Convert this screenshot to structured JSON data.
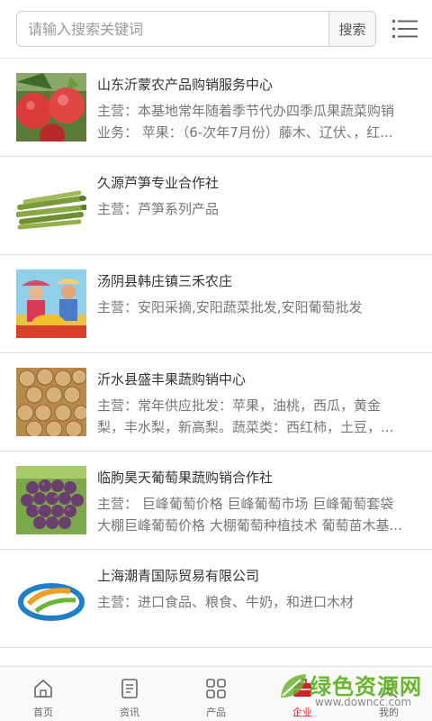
{
  "search": {
    "placeholder": "请输入搜索关键词",
    "button_label": "搜索"
  },
  "menu": {
    "icon": "list-menu-icon"
  },
  "companies": [
    {
      "name": "山东沂蒙农产品购销服务中心",
      "lines": [
        "主营：本基地常年随着季节代办四季瓜果蔬菜购销",
        "业务： 苹果：（6-次年7月份）藤木、辽伏、，红..."
      ],
      "image": "apples"
    },
    {
      "name": "久源芦笋专业合作社",
      "lines": [
        "主营：芦笋系列产品"
      ],
      "image": "asparagus"
    },
    {
      "name": "汤阴县韩庄镇三禾农庄",
      "lines": [
        "主营：安阳采摘,安阳蔬菜批发,安阳葡萄批发"
      ],
      "image": "farmers"
    },
    {
      "name": "沂水县盛丰果蔬购销中心",
      "lines": [
        "主营：常年供应批发：苹果，油桃，西瓜，黄金",
        "梨，丰水梨，新高梨。蔬菜类：西红柿，土豆，..."
      ],
      "image": "walnuts"
    },
    {
      "name": "临朐昊天葡萄果蔬购销合作社",
      "lines": [
        "主营： 巨峰葡萄价格 巨峰葡萄市场 巨峰葡萄套袋",
        "大棚巨峰葡萄价格 大棚葡萄种植技术 葡萄苗木基..."
      ],
      "image": "grapes"
    },
    {
      "name": "上海潮青国际贸易有限公司",
      "lines": [
        "主营：进口食品、粮食、牛奶，和进口木材"
      ],
      "image": "logo"
    }
  ],
  "tabs": [
    {
      "label": "首页",
      "icon": "home-icon",
      "active": false
    },
    {
      "label": "资讯",
      "icon": "news-icon",
      "active": false
    },
    {
      "label": "产品",
      "icon": "grid-icon",
      "active": false
    },
    {
      "label": "企业",
      "icon": "company-icon",
      "active": true
    },
    {
      "label": "我的",
      "icon": "user-icon",
      "active": false
    }
  ],
  "watermark": {
    "title": "绿色资源网",
    "url": "www.downcc.com"
  },
  "colors": {
    "accent": "#d4202a",
    "watermark_green": "#6ab532"
  }
}
